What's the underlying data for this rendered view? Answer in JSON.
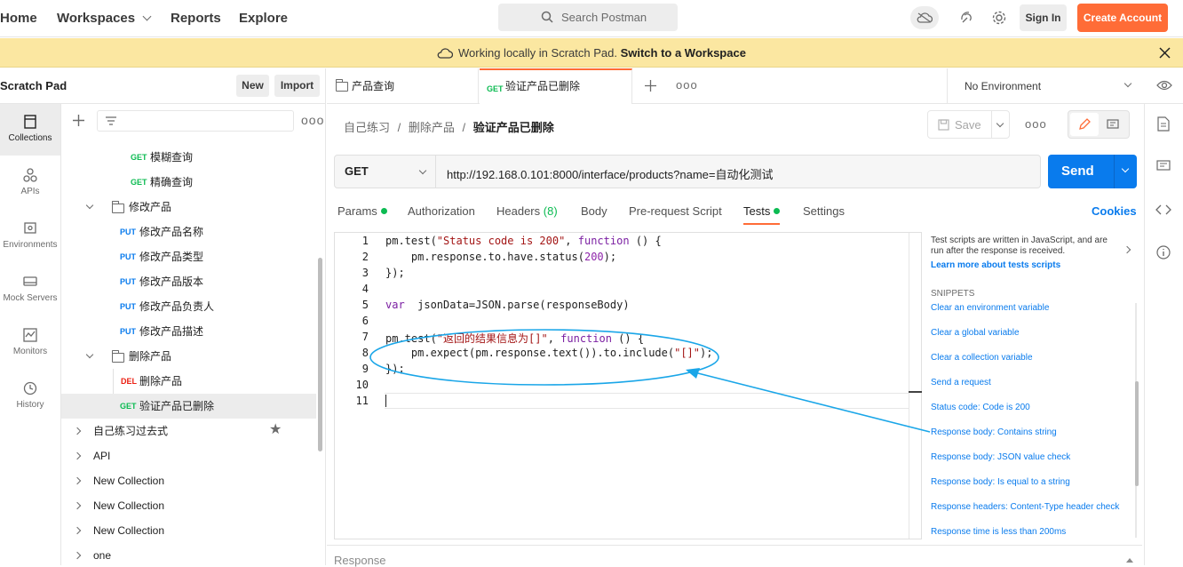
{
  "nav": {
    "home": "Home",
    "workspaces": "Workspaces",
    "reports": "Reports",
    "explore": "Explore"
  },
  "search": {
    "placeholder": "Search Postman"
  },
  "auth": {
    "signin": "Sign In",
    "create": "Create Account"
  },
  "banner": {
    "text": "Working locally in Scratch Pad.",
    "link": "Switch to a Workspace"
  },
  "scratchpad": {
    "title": "Scratch Pad",
    "new": "New",
    "import": "Import"
  },
  "iconbar": [
    {
      "label": "Collections",
      "icon": "collections-icon"
    },
    {
      "label": "APIs",
      "icon": "apis-icon"
    },
    {
      "label": "Environments",
      "icon": "environments-icon"
    },
    {
      "label": "Mock Servers",
      "icon": "mock-servers-icon"
    },
    {
      "label": "Monitors",
      "icon": "monitors-icon"
    },
    {
      "label": "History",
      "icon": "history-icon"
    }
  ],
  "tree": {
    "items": [
      {
        "method": "GET",
        "label": "模糊查询"
      },
      {
        "method": "GET",
        "label": "精确查询"
      },
      {
        "folder": "修改产品"
      },
      {
        "method": "PUT",
        "label": "修改产品名称"
      },
      {
        "method": "PUT",
        "label": "修改产品类型"
      },
      {
        "method": "PUT",
        "label": "修改产品版本"
      },
      {
        "method": "PUT",
        "label": "修改产品负责人"
      },
      {
        "method": "PUT",
        "label": "修改产品描述"
      },
      {
        "folder": "删除产品"
      },
      {
        "method": "DEL",
        "label": "删除产品"
      },
      {
        "method": "GET",
        "label": "验证产品已删除"
      },
      {
        "collection": "自己练习过去式"
      },
      {
        "collection": "API"
      },
      {
        "collection": "New Collection"
      },
      {
        "collection": "New Collection"
      },
      {
        "collection": "New Collection"
      },
      {
        "collection": "one"
      }
    ]
  },
  "tabs": [
    {
      "label": "产品查询"
    },
    {
      "method": "GET",
      "label": "验证产品已删除"
    }
  ],
  "environment": "No Environment",
  "breadcrumb": {
    "a": "自己练习",
    "b": "删除产品",
    "c": "验证产品已删除"
  },
  "toolbar": {
    "save": "Save"
  },
  "request": {
    "method": "GET",
    "url": "http://192.168.0.101:8000/interface/products?name=自动化测试",
    "send": "Send"
  },
  "reqtabs": {
    "params": "Params",
    "auth": "Authorization",
    "headers": "Headers",
    "headers_count": "(8)",
    "body": "Body",
    "prereq": "Pre-request Script",
    "tests": "Tests",
    "settings": "Settings",
    "cookies": "Cookies"
  },
  "editor": {
    "line_numbers": [
      "1",
      "2",
      "3",
      "4",
      "5",
      "6",
      "7",
      "8",
      "9",
      "10",
      "11"
    ]
  },
  "sidepanel": {
    "intro": "Test scripts are written in JavaScript, and are run after the response is received.",
    "learn": "Learn more about tests scripts",
    "snippets_title": "SNIPPETS",
    "snippets": [
      "Clear an environment variable",
      "Clear a global variable",
      "Clear a collection variable",
      "Send a request",
      "Status code: Code is 200",
      "Response body: Contains string",
      "Response body: JSON value check",
      "Response body: Is equal to a string",
      "Response headers: Content-Type header check",
      "Response time is less than 200ms"
    ]
  },
  "response": {
    "label": "Response"
  },
  "colors": {
    "accent": "#ff6c37",
    "send": "#097bed",
    "get": "#0cbb52",
    "put": "#097bed",
    "del": "#eb2013",
    "annotation": "#1aa6e8"
  }
}
